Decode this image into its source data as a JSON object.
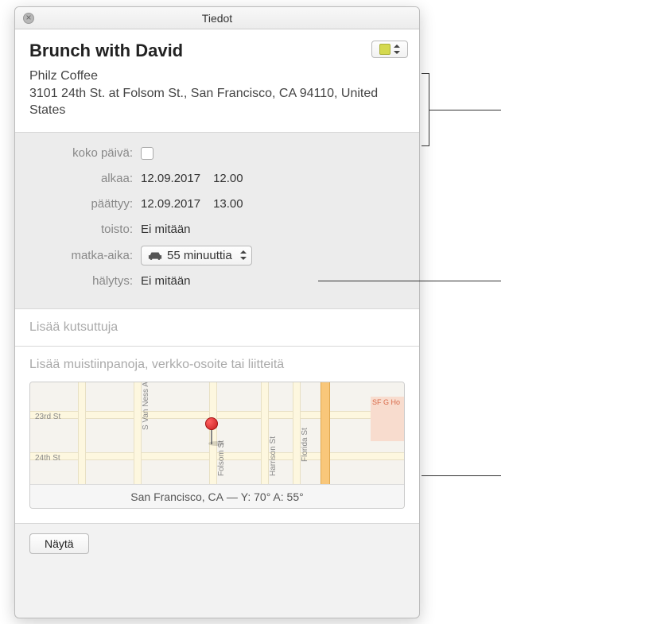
{
  "window": {
    "title": "Tiedot"
  },
  "event": {
    "title": "Brunch with David",
    "location_name": "Philz Coffee",
    "location_address": "3101 24th St. at Folsom St., San Francisco, CA 94110, United States",
    "calendar_color": "#d4d94f"
  },
  "details": {
    "all_day_label": "koko päivä:",
    "all_day_checked": false,
    "starts_label": "alkaa:",
    "starts_date": "12.09.2017",
    "starts_time": "12.00",
    "ends_label": "päättyy:",
    "ends_date": "12.09.2017",
    "ends_time": "13.00",
    "repeat_label": "toisto:",
    "repeat_value": "Ei mitään",
    "travel_label": "matka-aika:",
    "travel_value": "55 minuuttia",
    "alert_label": "hälytys:",
    "alert_value": "Ei mitään"
  },
  "invitees": {
    "placeholder": "Lisää kutsuttuja"
  },
  "notes": {
    "placeholder": "Lisää muistiinpanoja, verkko-osoite tai liitteitä"
  },
  "map": {
    "streets": {
      "h1": "23rd St",
      "h2": "24th St",
      "v1": "Folsom St",
      "v2": "Harrison St",
      "v3": "Florida St",
      "v4": "S Van Ness Ave"
    },
    "hospital": "SF G Ho",
    "footer_location": "San Francisco, CA",
    "footer_weather": "Y: 70° A: 55°"
  },
  "actions": {
    "show_button": "Näytä"
  }
}
